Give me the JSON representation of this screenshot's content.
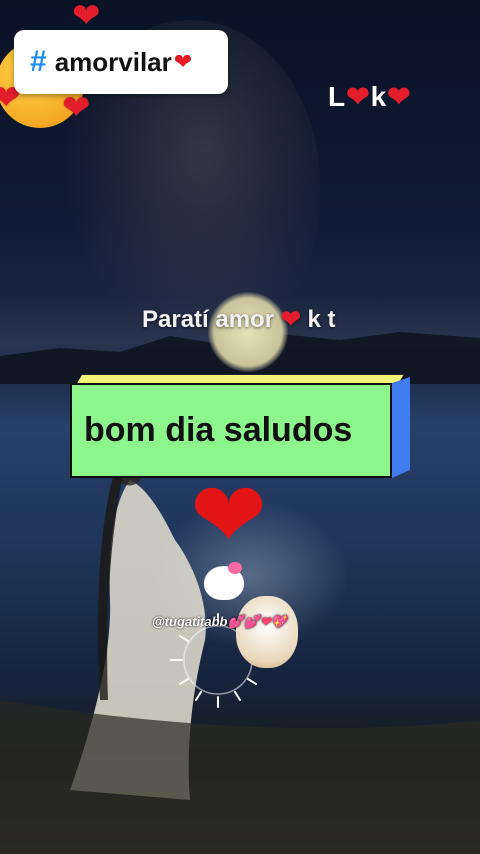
{
  "hashtag": {
    "symbol": "#",
    "text": "amorvilar",
    "heart": "❤"
  },
  "top_right_label": {
    "l": "L",
    "heart1": "❤",
    "k": "k",
    "heart2": "❤"
  },
  "caption": {
    "text": "Paratí amor",
    "heart": "❤",
    "suffix": "k t"
  },
  "banner": {
    "text": "bom dia saludos"
  },
  "big_heart": "❤",
  "watermark": {
    "handle": "@tugatitabb",
    "decor": "💕💕❤💖"
  },
  "colors": {
    "banner_front": "#8cf58c",
    "banner_top": "#f3f47a",
    "banner_side": "#3f7df0",
    "hashtag_blue": "#1d8cf8",
    "heart_red": "#e31d2b"
  },
  "icons": [
    "hashtag-icon",
    "smiling-face-with-hearts-icon",
    "heart-icon",
    "hello-kitty-icon",
    "audio-visualizer-ring-icon"
  ]
}
